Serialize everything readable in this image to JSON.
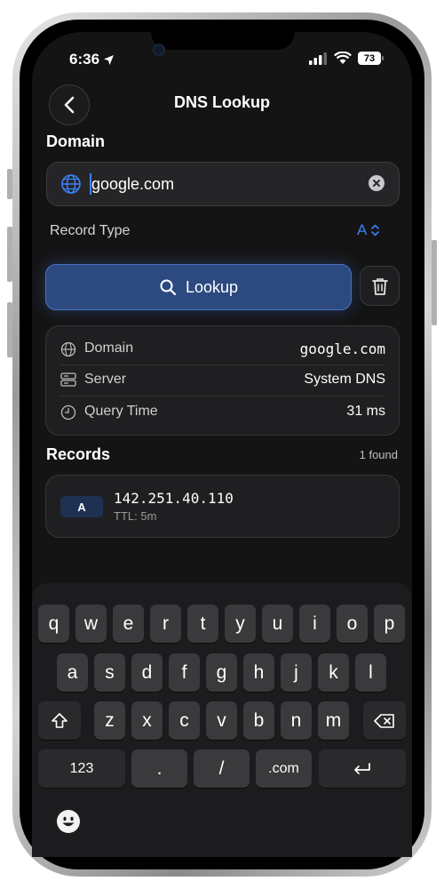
{
  "status_bar": {
    "time": "6:36",
    "battery": "73"
  },
  "header": {
    "title": "DNS Lookup"
  },
  "domain_section": {
    "label": "Domain",
    "input_value": "google.com"
  },
  "record_type": {
    "label": "Record Type",
    "selected": "A"
  },
  "actions": {
    "lookup_label": "Lookup"
  },
  "result_info": {
    "rows": [
      {
        "icon": "globe-icon",
        "label": "Domain",
        "value": "google.com"
      },
      {
        "icon": "server-icon",
        "label": "Server",
        "value": "System DNS"
      },
      {
        "icon": "clock-icon",
        "label": "Query Time",
        "value": "31 ms"
      }
    ]
  },
  "records": {
    "title": "Records",
    "count_text": "1 found",
    "items": [
      {
        "type": "A",
        "value": "142.251.40.110",
        "ttl": "TTL: 5m"
      }
    ]
  },
  "keyboard": {
    "row1": [
      "q",
      "w",
      "e",
      "r",
      "t",
      "y",
      "u",
      "i",
      "o",
      "p"
    ],
    "row2": [
      "a",
      "s",
      "d",
      "f",
      "g",
      "h",
      "j",
      "k",
      "l"
    ],
    "row3": [
      "z",
      "x",
      "c",
      "v",
      "b",
      "n",
      "m"
    ],
    "numbers_key": "123",
    "period_key": ".",
    "slash_key": "/",
    "dotcom_key": ".com"
  },
  "colors": {
    "accent": "#3b82f6",
    "background": "#141414",
    "card": "#1f1f21",
    "button": "#2c4a80"
  }
}
